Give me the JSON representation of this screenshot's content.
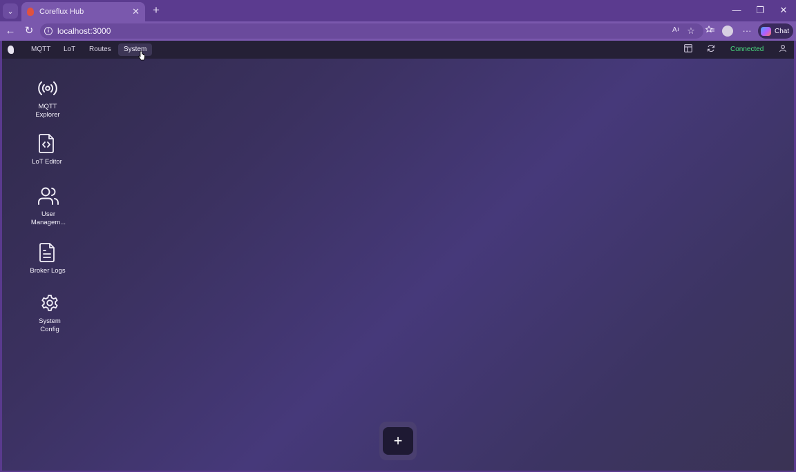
{
  "browser": {
    "tab_title": "Coreflux Hub",
    "tab_close": "✕",
    "new_tab": "+",
    "url": "localhost:3000",
    "chat_label": "Chat",
    "window_controls": [
      "—",
      "❐",
      "✕"
    ]
  },
  "app_header": {
    "menu": [
      {
        "label": "MQTT"
      },
      {
        "label": "LoT"
      },
      {
        "label": "Routes"
      },
      {
        "label": "System",
        "active": true
      }
    ],
    "status": "Connected",
    "status_color": "#4ade80"
  },
  "desktop": {
    "items": [
      {
        "label": "MQTT\nExplorer",
        "icon": "broadcast-icon"
      },
      {
        "label": "LoT Editor",
        "icon": "code-file-icon"
      },
      {
        "label": "User\nManagem...",
        "icon": "users-icon"
      },
      {
        "label": "Broker Logs",
        "icon": "document-icon"
      },
      {
        "label": "System\nConfig",
        "icon": "gear-icon"
      }
    ]
  },
  "add_button_label": "+"
}
